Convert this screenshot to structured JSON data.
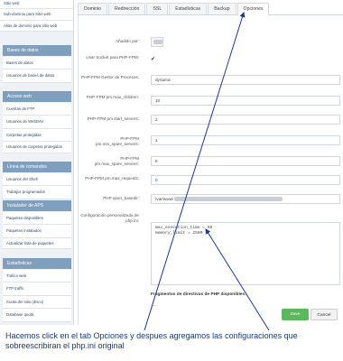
{
  "sidebar": {
    "top_links": [
      "Sitio web",
      "Sub-dominio para Sitio web",
      "Alias de dominio para sitio web"
    ],
    "sections": [
      {
        "title": "Bases de datos",
        "items": [
          "Bases de datos",
          "Usuarios de bases de datos"
        ]
      },
      {
        "title": "Acceso web",
        "items": [
          "Cuentas de FTP",
          "Usuarios de WebDAV",
          "Carpetas protegidas",
          "Usuarios de carpetas protegidas"
        ]
      },
      {
        "title": "Línea de comandos",
        "items": [
          "Usuarios del Shell",
          "Trabajos programados"
        ]
      },
      {
        "title": "Instalador de APS",
        "items": [
          "Paquetes disponibles",
          "Paquetes instalados",
          "Actualizar lista de paquetes"
        ]
      },
      {
        "title": "Estadísticas",
        "items": [
          "Trafico web",
          "FTP traffic",
          "Cuota del sitio (disco)",
          "Database quota"
        ]
      }
    ]
  },
  "tabs": [
    "Dominio",
    "Redirección",
    "SSL",
    "Estadísticas",
    "Backup",
    "Opciones"
  ],
  "active_tab": "Opciones",
  "form": {
    "fields": [
      {
        "label": "Añadido por:",
        "value": ""
      },
      {
        "label": "Usar Socket para PHP-FPM:",
        "value": "✔"
      },
      {
        "label": "PHP-FPM Gestor de Procesos:",
        "value": "dynamic"
      },
      {
        "label": "PHP-FPM pm.max_children:",
        "value": "10"
      },
      {
        "label": "PHP-FPM pm.start_servers:",
        "value": "2"
      },
      {
        "label": "PHP-FPM pm.min_spare_servers:",
        "value": "1"
      },
      {
        "label": "PHP-FPM pm.max_spare_servers:",
        "value": "5"
      },
      {
        "label": "PHP-FPM pm.max_requests:",
        "value": "0"
      },
      {
        "label": "PHP open_basedir:",
        "value": "/var/www/"
      },
      {
        "label": "Configuración personalizada de php.ini:",
        "value": "max_execution_time = 60\nmemory_limit = 256M"
      }
    ],
    "fragments_label": "Fragmentos de directivas de PHP disponibles:",
    "fragments_value": "----",
    "save_label": "Save",
    "cancel_label": "Cancel"
  },
  "caption": "Hacemos click en el tab Opciones y despues agregamos las configuraciones que sobreescribiran el php.ini original",
  "colors": {
    "arrow": "#1a3a9a",
    "caption": "#1a3a7a",
    "save": "#5cb85c",
    "sidebar_head": "#7f9fbf"
  }
}
